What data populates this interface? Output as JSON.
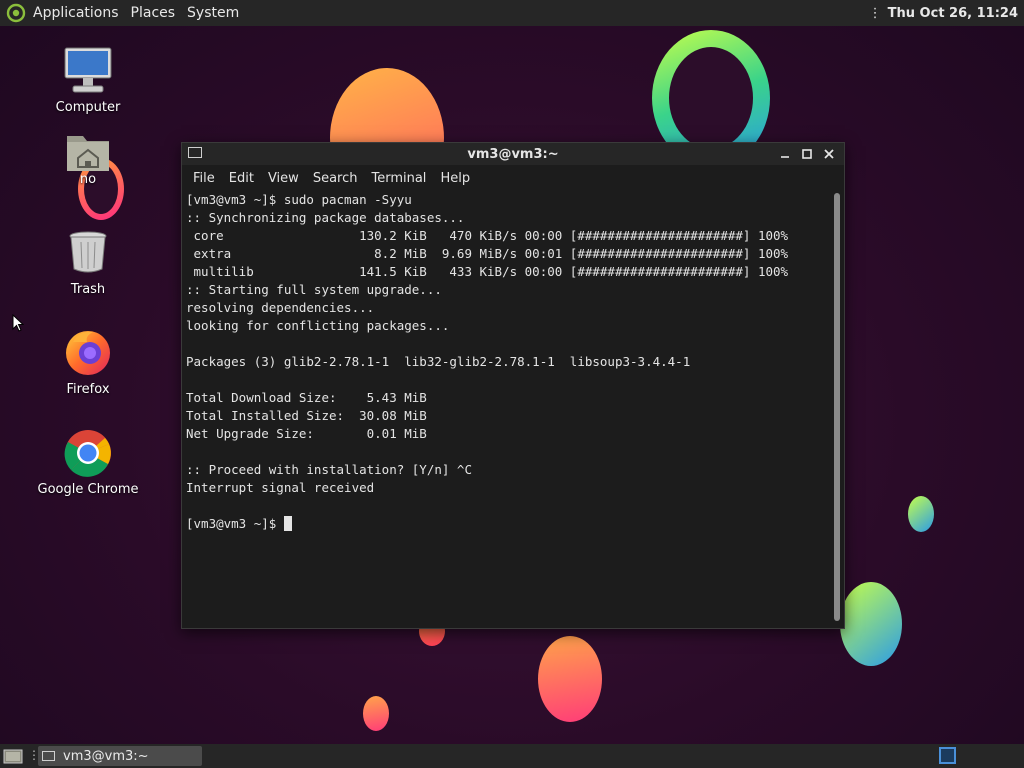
{
  "top_panel": {
    "menus": [
      "Applications",
      "Places",
      "System"
    ],
    "clock": "Thu Oct 26, 11:24"
  },
  "desktop": {
    "icons": [
      {
        "label": "Computer",
        "icon": "computer-icon"
      },
      {
        "label": "no",
        "icon": "home-folder-icon"
      },
      {
        "label": "Trash",
        "icon": "trash-icon"
      },
      {
        "label": "Firefox",
        "icon": "firefox-icon"
      },
      {
        "label": "Google Chrome",
        "icon": "chrome-icon"
      }
    ]
  },
  "terminal": {
    "title": "vm3@vm3:~",
    "menu": [
      "File",
      "Edit",
      "View",
      "Search",
      "Terminal",
      "Help"
    ],
    "lines": [
      "[vm3@vm3 ~]$ sudo pacman -Syyu",
      ":: Synchronizing package databases...",
      " core                  130.2 KiB   470 KiB/s 00:00 [######################] 100%",
      " extra                   8.2 MiB  9.69 MiB/s 00:01 [######################] 100%",
      " multilib              141.5 KiB   433 KiB/s 00:00 [######################] 100%",
      ":: Starting full system upgrade...",
      "resolving dependencies...",
      "looking for conflicting packages...",
      "",
      "Packages (3) glib2-2.78.1-1  lib32-glib2-2.78.1-1  libsoup3-3.4.4-1",
      "",
      "Total Download Size:    5.43 MiB",
      "Total Installed Size:  30.08 MiB",
      "Net Upgrade Size:       0.01 MiB",
      "",
      ":: Proceed with installation? [Y/n] ^C",
      "Interrupt signal received",
      ""
    ],
    "prompt": "[vm3@vm3 ~]$ "
  },
  "taskbar": {
    "task_label": "vm3@vm3:~"
  },
  "colors": {
    "panel": "#262626",
    "terminal_bg": "#1c1c1c",
    "desktop_bg": "#2c0d2a",
    "workspace_accent": "#4a90d9"
  }
}
